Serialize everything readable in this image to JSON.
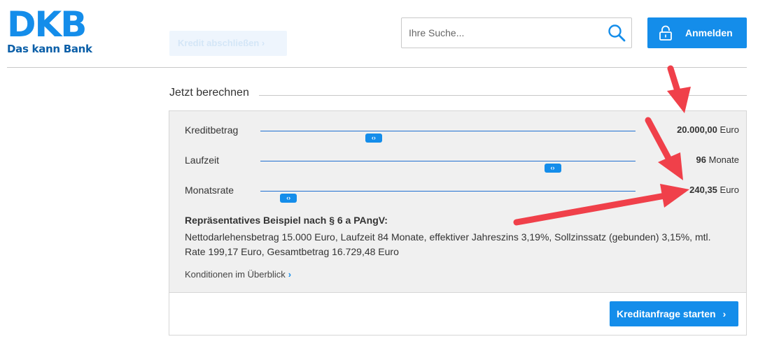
{
  "logo": {
    "main": "DKB",
    "tagline": "Das kann Bank"
  },
  "header": {
    "ghost_button": "Kredit abschließen  ›",
    "search_placeholder": "Ihre Suche...",
    "login_label": "Anmelden"
  },
  "calculator": {
    "title": "Jetzt berechnen",
    "rows": [
      {
        "label": "Kreditbetrag",
        "value": "20.000,00",
        "unit": "Euro",
        "slider_fraction": 0.302
      },
      {
        "label": "Laufzeit",
        "value": "96",
        "unit": "Monate",
        "slider_fraction": 0.779
      },
      {
        "label": "Monatsrate",
        "value": "240,35",
        "unit": "Euro",
        "slider_fraction": 0.075
      }
    ],
    "example_title": "Repräsentatives Beispiel nach § 6 a PAngV:",
    "example_text": "Nettodarlehensbetrag 15.000 Euro, Laufzeit 84 Monate, effektiver Jahreszins 3,19%, Sollzinssatz (gebunden) 3,15%, mtl. Rate 199,17 Euro, Gesamtbetrag 16.729,48 Euro",
    "conditions_link": "Konditionen im Überblick",
    "cta_label": "Kreditanfrage starten"
  },
  "colors": {
    "brand": "#148dea",
    "annotation": "#f0404a"
  },
  "icons": {
    "search": "search-icon",
    "lock": "lock-icon",
    "slider_handle": "chevron-left-right-icon"
  }
}
